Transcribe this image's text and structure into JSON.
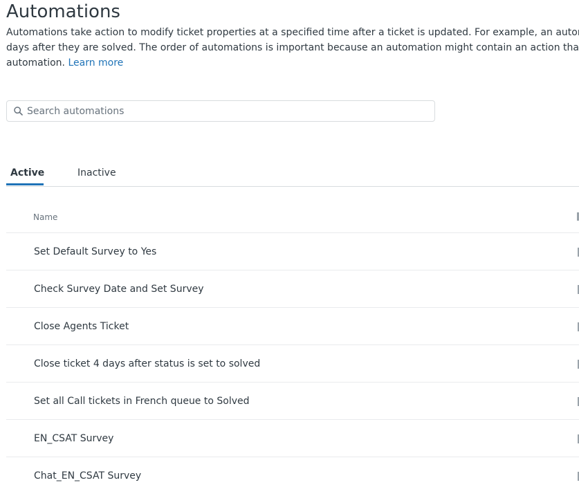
{
  "page": {
    "title": "Automations",
    "description_line1": "Automations take action to modify ticket properties at a specified time after a ticket is updated. For example, an automation can close tickets",
    "description_line2": "days after they are solved. The order of automations is important because an automation might contain an action that activates another",
    "description_line3": "automation.",
    "learn_more": "Learn more"
  },
  "search": {
    "placeholder": "Search automations",
    "value": ""
  },
  "tabs": [
    {
      "label": "Active",
      "selected": true
    },
    {
      "label": "Inactive",
      "selected": false
    }
  ],
  "table": {
    "columns": [
      "Name"
    ],
    "rows": [
      "Set Default Survey to Yes",
      "Check Survey Date and Set Survey",
      "Close Agents Ticket",
      "Close ticket 4 days after status is set to solved",
      "Set all Call tickets in French queue to Solved",
      "EN_CSAT Survey",
      "Chat_EN_CSAT Survey"
    ]
  },
  "colors": {
    "accent": "#1f73b7",
    "text": "#2f3941",
    "muted": "#68737d",
    "border": "#d8dcde"
  },
  "icons": {
    "search": "search-icon"
  }
}
